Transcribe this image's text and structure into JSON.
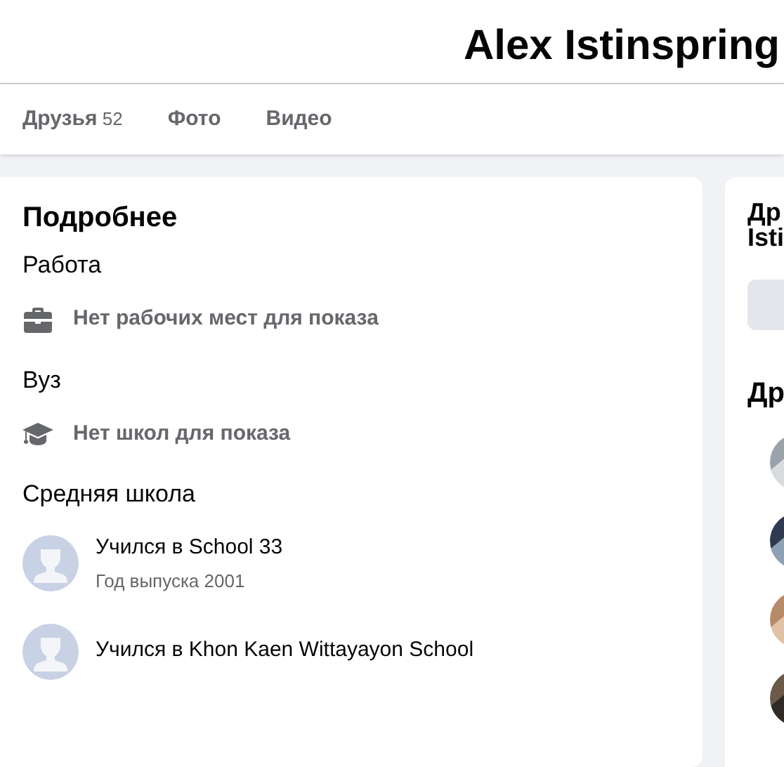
{
  "profile": {
    "name": "Alex Istinspring"
  },
  "tabs": [
    {
      "label": "Друзья",
      "count": "52",
      "selected": false
    },
    {
      "label": "Фото",
      "selected": false
    },
    {
      "label": "Видео",
      "selected": false
    }
  ],
  "details": {
    "title": "Подробнее",
    "sections": [
      {
        "heading": "Работа",
        "kind": "work",
        "text": "Нет рабочих мест для показа"
      },
      {
        "heading": "Вуз",
        "kind": "education",
        "text": "Нет школ для показа"
      },
      {
        "heading": "Средняя школа",
        "kind": "schools",
        "items": [
          {
            "text": "Учился в School 33",
            "subtext": "Год выпуска 2001"
          },
          {
            "text": "Учился в Khon Kaen Wittayayon School"
          }
        ]
      }
    ]
  },
  "side_card": {
    "title_lines": [
      "Др",
      "Isti"
    ],
    "heading": "Др",
    "photos": [
      {
        "kind": "picture"
      },
      {
        "kind": "picture"
      },
      {
        "kind": "picture"
      },
      {
        "kind": "picture"
      }
    ]
  }
}
